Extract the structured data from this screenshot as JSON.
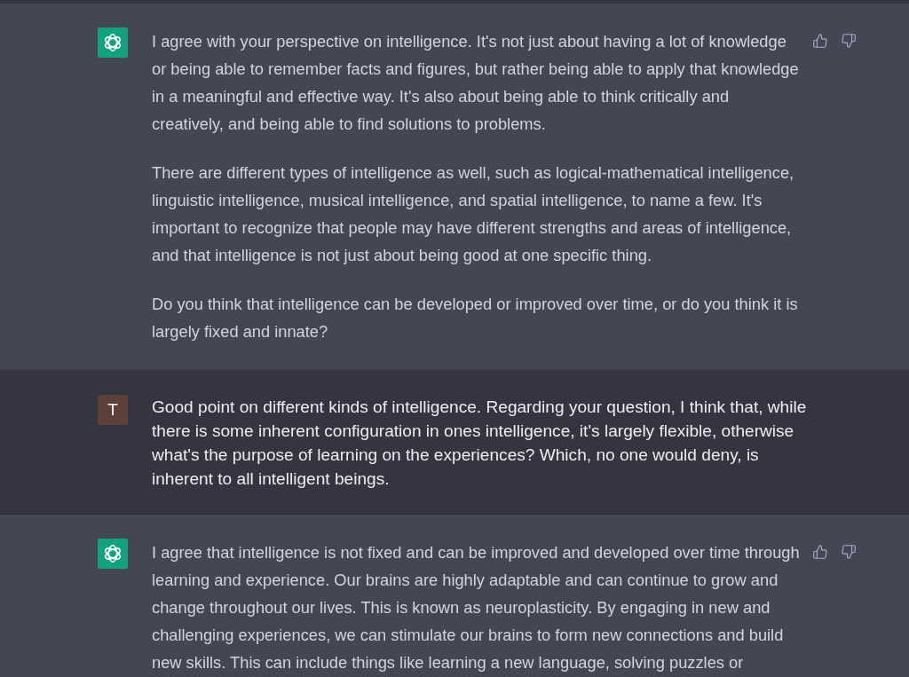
{
  "messages": [
    {
      "kind": "assistant",
      "paragraphs": [
        "I agree with your perspective on intelligence. It's not just about having a lot of knowledge or being able to remember facts and figures, but rather being able to apply that knowledge in a meaningful and effective way. It's also about being able to think critically and creatively, and being able to find solutions to problems.",
        "There are different types of intelligence as well, such as logical-mathematical intelligence, linguistic intelligence, musical intelligence, and spatial intelligence, to name a few. It's important to recognize that people may have different strengths and areas of intelligence, and that intelligence is not just about being good at one specific thing.",
        "Do you think that intelligence can be developed or improved over time, or do you think it is largely fixed and innate?"
      ]
    },
    {
      "kind": "user",
      "avatar_letter": "T",
      "paragraphs": [
        "Good point on different kinds of intelligence. Regarding your question, I think that, while there is some inherent configuration in ones intelligence, it's largely flexible, otherwise what's the purpose of learning on the experiences? Which, no one would deny, is inherent to all intelligent beings."
      ]
    },
    {
      "kind": "assistant",
      "paragraphs": [
        "I agree that intelligence is not fixed and can be improved and developed over time through learning and experience. Our brains are highly adaptable and can continue to grow and change throughout our lives. This is known as neuroplasticity. By engaging in new and challenging experiences, we can stimulate our brains to form new connections and build new skills. This can include things like learning a new language, solving puzzles or"
      ]
    }
  ]
}
